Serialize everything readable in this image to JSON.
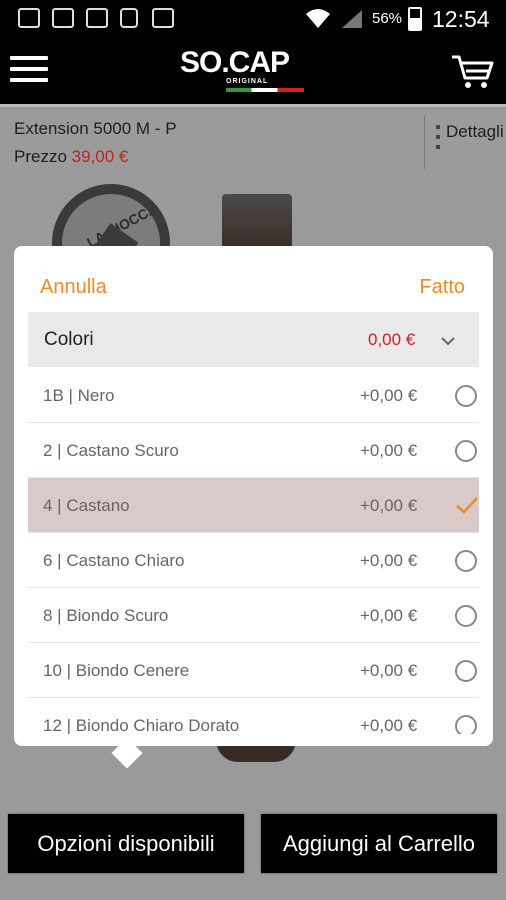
{
  "status_bar": {
    "battery": "56%",
    "time": "12:54"
  },
  "header": {
    "logo_text": "SO.CAP",
    "logo_sub": "ORIGINAL"
  },
  "product": {
    "name": "Extension 5000 M - P",
    "price_label": "Prezzo",
    "price_value": "39,00 €",
    "details_label": "Dettagli"
  },
  "badge_text": "LA CIOCCA CON LA",
  "popup": {
    "cancel": "Annulla",
    "done": "Fatto",
    "section_title": "Colori",
    "section_price": "0,00 €",
    "options": [
      {
        "label": "1B | Nero",
        "price": "+0,00 €",
        "selected": false
      },
      {
        "label": "2 | Castano Scuro",
        "price": "+0,00 €",
        "selected": false
      },
      {
        "label": "4 | Castano",
        "price": "+0,00 €",
        "selected": true
      },
      {
        "label": "6 | Castano Chiaro",
        "price": "+0,00 €",
        "selected": false
      },
      {
        "label": "8 | Biondo Scuro",
        "price": "+0,00 €",
        "selected": false
      },
      {
        "label": "10 | Biondo Cenere",
        "price": "+0,00 €",
        "selected": false
      },
      {
        "label": "12 | Biondo Chiaro Dorato",
        "price": "+0,00 €",
        "selected": false
      }
    ]
  },
  "buttons": {
    "options": "Opzioni disponibili",
    "add_to_cart": "Aggiungi al Carrello"
  },
  "colors": {
    "accent": "#f08a2a",
    "price_red": "#d31f1f",
    "selected_row": "#d9c9c9"
  }
}
